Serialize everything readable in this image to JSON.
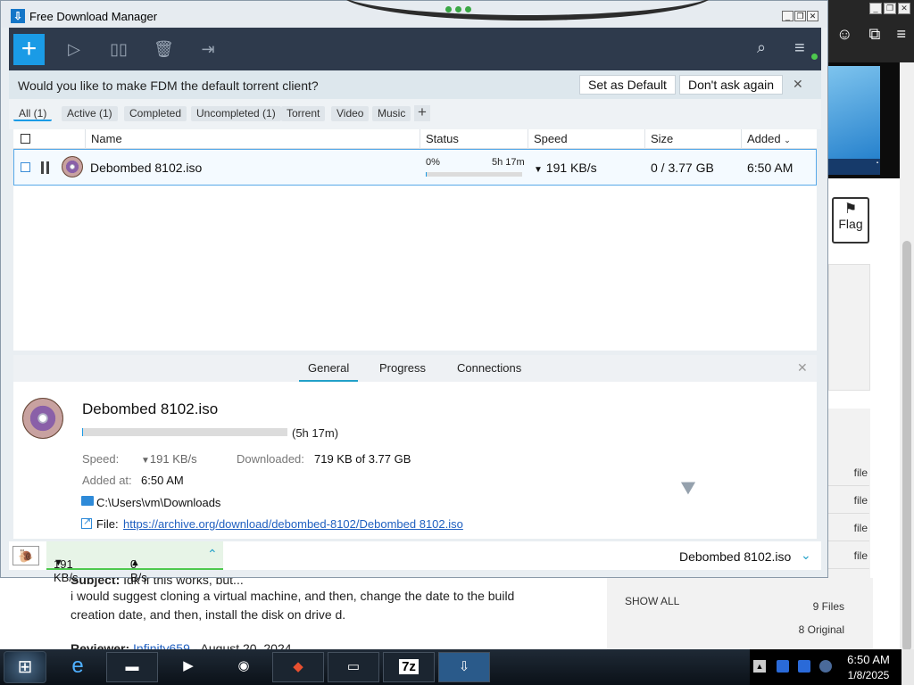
{
  "window": {
    "title": "Free Download Manager"
  },
  "toolbar": {
    "add_icon": "plus-icon",
    "resume_icon": "play-icon",
    "stop_icon": "stop-icon",
    "delete_icon": "trash-icon",
    "move_icon": "folder-move-icon",
    "search_icon": "search-icon",
    "menu_icon": "hamburger-menu-icon"
  },
  "banner": {
    "text": "Would you like to make FDM the default torrent client?",
    "set_default": "Set as Default",
    "dont_ask": "Don't ask again",
    "close": "✕"
  },
  "filters": [
    {
      "label": "All (1)",
      "active": true
    },
    {
      "label": "Active (1)",
      "active": false
    },
    {
      "label": "Completed",
      "active": false
    },
    {
      "label": "Uncompleted (1)",
      "active": false
    },
    {
      "label": "Torrent",
      "active": false
    },
    {
      "label": "Video",
      "active": false
    },
    {
      "label": "Music",
      "active": false
    }
  ],
  "filter_add": "+",
  "columns": {
    "name": "Name",
    "status": "Status",
    "speed": "Speed",
    "size": "Size",
    "added": "Added"
  },
  "downloads": [
    {
      "name": "Debombed 8102.iso",
      "progress_pct": "0%",
      "progress_value": 0.002,
      "eta": "5h 17m",
      "speed": "191 KB/s",
      "size": "0 / 3.77 GB",
      "added": "6:50 AM"
    }
  ],
  "details": {
    "tabs": [
      "General",
      "Progress",
      "Connections"
    ],
    "active_tab": "General",
    "title": "Debombed 8102.iso",
    "eta": "(5h 17m)",
    "progress_value": 0.002,
    "speed_label": "Speed:",
    "speed_value": "191 KB/s",
    "downloaded_label": "Downloaded:",
    "downloaded_value": "719 KB of 3.77 GB",
    "added_label": "Added at:",
    "added_value": "6:50 AM",
    "folder": "C:\\Users\\vm\\Downloads",
    "file_label": "File:",
    "file_url": "https://archive.org/download/debombed-8102/Debombed 8102.iso"
  },
  "statusbar": {
    "download_speed": "191 KB/s",
    "upload_speed": "0 B/s",
    "current_file": "Debombed 8102.iso"
  },
  "background": {
    "flag_label": "Flag",
    "file_links": [
      "file",
      "file",
      "file",
      "file"
    ],
    "show_all": "SHOW ALL",
    "files_count": "9 Files",
    "original_count": "8 Original",
    "review_subject": "Subject:",
    "review_subject_text": "Idk if this works, but...",
    "review_line1": "i would suggest cloning a virtual machine, and then, change the date to the build",
    "review_line2": "creation date, and then, install the disk on drive d.",
    "reviewer_label": "Reviewer:",
    "reviewer_name": "Infinity659",
    "reviewer_date": "- August 20, 2024"
  },
  "taskbar": {
    "apps": [
      "ie-icon",
      "terminal-icon",
      "media-player-icon",
      "globe-icon",
      "fox-icon",
      "cmd-icon",
      "7zip-icon",
      "fdm-icon"
    ],
    "seven_zip": "7z",
    "time": "6:50 AM",
    "date": "1/8/2025"
  },
  "colors": {
    "accent": "#1a9be6",
    "toolbar_bg": "#2e3a4c",
    "banner_bg": "#dde7ed",
    "selected_row_border": "#57a9e8",
    "speed_bar_green": "#4ec94e"
  }
}
